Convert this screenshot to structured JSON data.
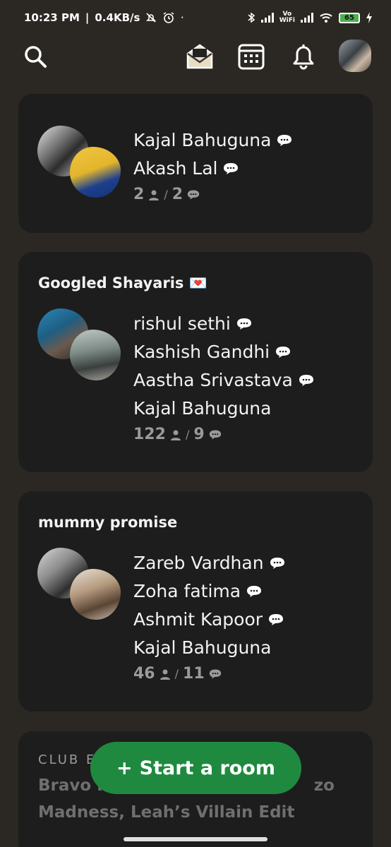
{
  "status_bar": {
    "time": "10:23 PM",
    "speed": "0.4KB/s",
    "battery": "65",
    "vowifi_top": "Vo",
    "vowifi_bottom": "WiFi"
  },
  "top_bar": {
    "icons": [
      "search-icon",
      "mail-icon",
      "calendar-icon",
      "bell-icon",
      "avatar"
    ]
  },
  "rooms": [
    {
      "title": "",
      "people": [
        {
          "name": "Kajal Bahuguna",
          "speaking": true
        },
        {
          "name": "Akash Lal",
          "speaking": true
        }
      ],
      "listeners": "2",
      "speakers": "2"
    },
    {
      "title": "Googled Shayaris 💌",
      "people": [
        {
          "name": "rishul sethi",
          "speaking": true
        },
        {
          "name": "Kashish Gandhi",
          "speaking": true
        },
        {
          "name": "Aastha Srivastava",
          "speaking": true
        },
        {
          "name": "Kajal Bahuguna",
          "speaking": false
        }
      ],
      "listeners": "122",
      "speakers": "9"
    },
    {
      "title": "mummy promise",
      "people": [
        {
          "name": "Zareb Vardhan",
          "speaking": true
        },
        {
          "name": "Zoha fatima",
          "speaking": true
        },
        {
          "name": "Ashmit Kapoor",
          "speaking": true
        },
        {
          "name": "Kajal Bahuguna",
          "speaking": false
        }
      ],
      "listeners": "46",
      "speakers": "11"
    }
  ],
  "club": {
    "label": "CLUB E",
    "text_line1": "Bravo I",
    "text_line1_tail": "zo",
    "text_line2": "Madness, Leah’s Villain Edit"
  },
  "start_room": {
    "plus": "+",
    "label": "Start a room"
  },
  "separator": "/",
  "colors": {
    "background": "#2b2824",
    "card": "#1d1d1d",
    "accent_green": "#1f8a3f",
    "muted_text": "#9a9a9a"
  }
}
